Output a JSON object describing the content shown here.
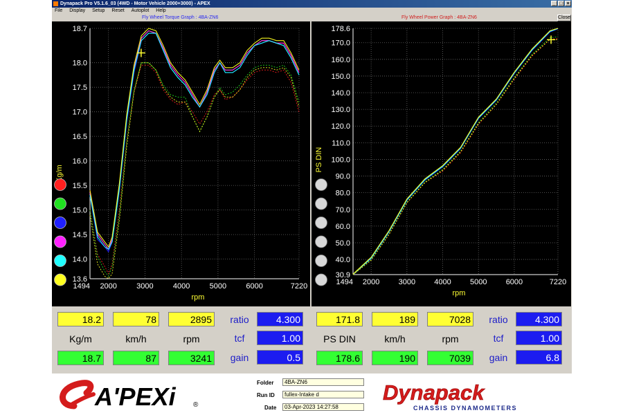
{
  "window": {
    "title": "Dynapack Pro V5.1.6_03 (4WD - Motor Vehicle 2000+3000) - APEX",
    "minimize": "_",
    "maximize": "□",
    "close": "×"
  },
  "menu": [
    "File",
    "Display",
    "Setup",
    "Reset",
    "Autoplot",
    "Help"
  ],
  "close_button": "Close",
  "torque_graph": {
    "title": "Fly Wheel Torque Graph : 4BA-ZN6",
    "ylabel": "Kg/m",
    "xlabel": "rpm"
  },
  "power_graph": {
    "title": "Fly Wheel Power Graph : 4BA-ZN6",
    "ylabel": "PS DIN",
    "xlabel": "rpm"
  },
  "run_colors": [
    "#ff2020",
    "#20e020",
    "#2020ff",
    "#ff20ff",
    "#20ffff",
    "#ffff20"
  ],
  "chart_data": [
    {
      "type": "line",
      "title": "Fly Wheel Torque Graph : 4BA-ZN6",
      "xlabel": "rpm",
      "ylabel": "Kg/m",
      "xlim": [
        1494,
        7220
      ],
      "ylim": [
        13.6,
        18.7
      ],
      "x_ticks": [
        "1494",
        "2000",
        "3000",
        "4000",
        "5000",
        "6000",
        "7220"
      ],
      "y_ticks": [
        "18.7",
        "18.0",
        "17.5",
        "17.0",
        "16.5",
        "16.0",
        "15.5",
        "15.0",
        "14.5",
        "14.0",
        "13.6"
      ],
      "grid": true,
      "series": [
        {
          "color": "#ff2020",
          "dotted": false,
          "x": [
            1494,
            1700,
            1900,
            2000,
            2100,
            2300,
            2500,
            2700,
            2900,
            3100,
            3300,
            3500,
            3700,
            3900,
            4100,
            4300,
            4500,
            4700,
            4900,
            5050,
            5200,
            5400,
            5600,
            5800,
            6000,
            6200,
            6400,
            6600,
            6800,
            7000,
            7220
          ],
          "y": [
            15.4,
            14.5,
            14.3,
            14.2,
            14.4,
            15.5,
            16.9,
            17.9,
            18.5,
            18.65,
            18.6,
            18.3,
            17.95,
            17.75,
            17.6,
            17.35,
            17.1,
            17.4,
            17.85,
            18.0,
            17.85,
            17.85,
            17.95,
            18.2,
            18.35,
            18.45,
            18.45,
            18.4,
            18.4,
            18.15,
            17.8
          ]
        },
        {
          "color": "#20e020",
          "dotted": false,
          "x": [
            1494,
            1700,
            1900,
            2000,
            2100,
            2300,
            2500,
            2700,
            2900,
            3100,
            3300,
            3500,
            3700,
            3900,
            4100,
            4300,
            4500,
            4700,
            4900,
            5050,
            5200,
            5400,
            5600,
            5800,
            6000,
            6200,
            6400,
            6600,
            6800,
            7000,
            7220
          ],
          "y": [
            15.3,
            14.5,
            14.3,
            14.2,
            14.35,
            15.4,
            16.9,
            17.9,
            18.5,
            18.65,
            18.6,
            18.3,
            17.9,
            17.7,
            17.55,
            17.3,
            17.1,
            17.4,
            17.85,
            18.0,
            17.85,
            17.85,
            17.95,
            18.2,
            18.35,
            18.45,
            18.45,
            18.4,
            18.35,
            18.1,
            17.75
          ]
        },
        {
          "color": "#2020ff",
          "dotted": false,
          "x": [
            1494,
            1700,
            1900,
            2000,
            2100,
            2300,
            2500,
            2700,
            2900,
            3100,
            3300,
            3500,
            3700,
            3900,
            4100,
            4300,
            4500,
            4700,
            4900,
            5050,
            5200,
            5400,
            5600,
            5800,
            6000,
            6200,
            6400,
            6600,
            6800,
            7000,
            7220
          ],
          "y": [
            15.3,
            14.4,
            14.25,
            14.15,
            14.35,
            15.4,
            16.8,
            17.8,
            18.45,
            18.6,
            18.6,
            18.25,
            17.9,
            17.7,
            17.55,
            17.3,
            17.1,
            17.35,
            17.8,
            18.0,
            17.8,
            17.8,
            17.9,
            18.15,
            18.35,
            18.4,
            18.45,
            18.4,
            18.35,
            18.1,
            17.75
          ]
        },
        {
          "color": "#ff20ff",
          "dotted": false,
          "x": [
            1494,
            1700,
            1900,
            2000,
            2100,
            2300,
            2500,
            2700,
            2900,
            3100,
            3300,
            3500,
            3700,
            3900,
            4100,
            4300,
            4500,
            4700,
            4900,
            5050,
            5200,
            5400,
            5600,
            5800,
            6000,
            6200,
            6400,
            6600,
            6800,
            7000,
            7220
          ],
          "y": [
            15.35,
            14.5,
            14.3,
            14.2,
            14.4,
            15.5,
            16.9,
            17.9,
            18.5,
            18.65,
            18.6,
            18.3,
            17.95,
            17.75,
            17.6,
            17.35,
            17.1,
            17.4,
            17.85,
            18.0,
            17.85,
            17.85,
            17.95,
            18.2,
            18.35,
            18.45,
            18.45,
            18.4,
            18.4,
            18.15,
            17.8
          ]
        },
        {
          "color": "#20ffff",
          "dotted": false,
          "x": [
            1494,
            1700,
            1900,
            2000,
            2100,
            2300,
            2500,
            2700,
            2900,
            3100,
            3300,
            3500,
            3700,
            3900,
            4100,
            4300,
            4500,
            4700,
            4900,
            5050,
            5200,
            5400,
            5600,
            5800,
            6000,
            6200,
            6400,
            6600,
            6800,
            7000,
            7220
          ],
          "y": [
            15.3,
            14.45,
            14.25,
            14.2,
            14.35,
            15.45,
            16.85,
            17.85,
            18.45,
            18.6,
            18.6,
            18.25,
            17.9,
            17.7,
            17.55,
            17.3,
            17.1,
            17.35,
            17.8,
            18.0,
            17.8,
            17.8,
            17.9,
            18.15,
            18.35,
            18.4,
            18.45,
            18.4,
            18.35,
            18.1,
            17.75
          ]
        },
        {
          "color": "#ffff20",
          "dotted": false,
          "x": [
            1494,
            1700,
            1900,
            2000,
            2100,
            2300,
            2500,
            2700,
            2900,
            3100,
            3300,
            3500,
            3700,
            3900,
            4100,
            4300,
            4500,
            4700,
            4900,
            5050,
            5200,
            5400,
            5600,
            5800,
            6000,
            6200,
            6400,
            6600,
            6800,
            7000,
            7220
          ],
          "y": [
            15.4,
            14.55,
            14.35,
            14.25,
            14.45,
            15.55,
            16.95,
            17.95,
            18.55,
            18.7,
            18.65,
            18.35,
            18.0,
            17.8,
            17.65,
            17.4,
            17.15,
            17.45,
            17.9,
            18.05,
            17.9,
            17.9,
            18.0,
            18.25,
            18.4,
            18.5,
            18.5,
            18.45,
            18.45,
            18.2,
            17.85
          ]
        },
        {
          "color": "#ff2020",
          "dotted": true,
          "x": [
            1494,
            1700,
            1900,
            2000,
            2100,
            2300,
            2500,
            2700,
            2900,
            3100,
            3300,
            3500,
            3700,
            3900,
            4100,
            4300,
            4500,
            4700,
            4900,
            5050,
            5200,
            5400,
            5600,
            5800,
            6000,
            6200,
            6400,
            6600,
            6800,
            7000,
            7220
          ],
          "y": [
            15.0,
            14.1,
            13.85,
            13.7,
            13.9,
            15.0,
            16.4,
            17.4,
            17.95,
            17.95,
            17.8,
            17.45,
            17.25,
            17.15,
            17.2,
            17.0,
            16.75,
            17.0,
            17.35,
            17.45,
            17.25,
            17.3,
            17.45,
            17.65,
            17.8,
            17.85,
            17.85,
            17.8,
            17.85,
            17.6,
            17.0
          ]
        },
        {
          "color": "#20e020",
          "dotted": true,
          "x": [
            1494,
            1700,
            1900,
            2000,
            2100,
            2300,
            2500,
            2700,
            2900,
            3100,
            3300,
            3500,
            3700,
            3900,
            4100,
            4300,
            4500,
            4700,
            4900,
            5050,
            5200,
            5400,
            5600,
            5800,
            6000,
            6200,
            6400,
            6600,
            6800,
            7000,
            7220
          ],
          "y": [
            15.0,
            14.05,
            13.75,
            13.65,
            13.85,
            14.9,
            16.4,
            17.45,
            18.0,
            18.0,
            17.85,
            17.55,
            17.35,
            17.3,
            17.3,
            16.9,
            16.6,
            16.9,
            17.3,
            17.5,
            17.35,
            17.4,
            17.55,
            17.75,
            17.9,
            17.95,
            17.95,
            17.9,
            17.95,
            17.75,
            17.2
          ]
        },
        {
          "color": "#ffff20",
          "dotted": true,
          "x": [
            1494,
            1700,
            1900,
            2000,
            2100,
            2300,
            2500,
            2700,
            2900,
            3100,
            3300,
            3500,
            3700,
            3900,
            4100,
            4300,
            4500,
            4700,
            4900,
            5050,
            5200,
            5400,
            5600,
            5800,
            6000,
            6200,
            6400,
            6600,
            6800,
            7000,
            7220
          ],
          "y": [
            14.9,
            13.9,
            13.65,
            13.6,
            13.7,
            14.8,
            16.3,
            17.4,
            18.0,
            18.0,
            17.85,
            17.5,
            17.3,
            17.2,
            17.2,
            16.9,
            16.6,
            16.9,
            17.3,
            17.45,
            17.3,
            17.3,
            17.45,
            17.7,
            17.85,
            17.9,
            17.9,
            17.85,
            17.9,
            17.7,
            17.1
          ]
        }
      ]
    },
    {
      "type": "line",
      "title": "Fly Wheel Power Graph : 4BA-ZN6",
      "xlabel": "rpm",
      "ylabel": "PS DIN",
      "xlim": [
        1494,
        7220
      ],
      "ylim": [
        30.9,
        178.6
      ],
      "x_ticks": [
        "1494",
        "2000",
        "3000",
        "4000",
        "5000",
        "6000",
        "7220"
      ],
      "y_ticks": [
        "178.6",
        "170.0",
        "160.0",
        "150.0",
        "140.0",
        "130.0",
        "120.0",
        "110.0",
        "100.0",
        "90.0",
        "80.0",
        "70.0",
        "60.0",
        "50.0",
        "40.0",
        "30.9"
      ],
      "grid": true,
      "series": [
        {
          "color": "#ff2020",
          "dotted": false,
          "x": [
            1494,
            2000,
            2500,
            3000,
            3500,
            4000,
            4500,
            5000,
            5500,
            6000,
            6500,
            7000,
            7220
          ],
          "y": [
            30.9,
            41,
            57,
            76,
            88,
            96,
            107,
            125,
            136,
            152,
            166,
            177,
            178.6
          ]
        },
        {
          "color": "#20e020",
          "dotted": false,
          "x": [
            1494,
            2000,
            2500,
            3000,
            3500,
            4000,
            4500,
            5000,
            5500,
            6000,
            6500,
            7000,
            7220
          ],
          "y": [
            30.9,
            41,
            57,
            76,
            88,
            96,
            107,
            125,
            136,
            152,
            166,
            177,
            178.6
          ]
        },
        {
          "color": "#2020ff",
          "dotted": false,
          "x": [
            1494,
            2000,
            2500,
            3000,
            3500,
            4000,
            4500,
            5000,
            5500,
            6000,
            6500,
            7000,
            7220
          ],
          "y": [
            30.9,
            40.5,
            56.5,
            75.5,
            87.5,
            95.5,
            106.5,
            124.5,
            135.5,
            151.5,
            165.5,
            176.5,
            178.3
          ]
        },
        {
          "color": "#ff20ff",
          "dotted": false,
          "x": [
            1494,
            2000,
            2500,
            3000,
            3500,
            4000,
            4500,
            5000,
            5500,
            6000,
            6500,
            7000,
            7220
          ],
          "y": [
            30.9,
            41,
            57,
            76,
            88,
            96,
            107,
            125,
            136,
            152,
            166,
            177,
            178.6
          ]
        },
        {
          "color": "#20ffff",
          "dotted": false,
          "x": [
            1494,
            2000,
            2500,
            3000,
            3500,
            4000,
            4500,
            5000,
            5500,
            6000,
            6500,
            7000,
            7220
          ],
          "y": [
            30.9,
            40.8,
            56.8,
            75.8,
            87.8,
            95.8,
            106.8,
            124.8,
            135.8,
            151.8,
            165.8,
            176.8,
            178.5
          ]
        },
        {
          "color": "#ffff20",
          "dotted": false,
          "x": [
            1494,
            2000,
            2500,
            3000,
            3500,
            4000,
            4500,
            5000,
            5500,
            6000,
            6500,
            7000,
            7220
          ],
          "y": [
            31.2,
            41.3,
            57.3,
            76.3,
            88.3,
            96.3,
            107.3,
            125.3,
            136.3,
            152.3,
            166.3,
            177.2,
            178.6
          ]
        },
        {
          "color": "#ff2020",
          "dotted": true,
          "x": [
            1494,
            2000,
            2500,
            3000,
            3500,
            4000,
            4500,
            5000,
            5500,
            6000,
            6500,
            7000,
            7220
          ],
          "y": [
            30.9,
            40,
            55,
            74,
            86,
            93,
            104,
            121,
            133,
            148,
            162,
            172,
            172.5
          ]
        },
        {
          "color": "#20e020",
          "dotted": true,
          "x": [
            1494,
            2000,
            2500,
            3000,
            3500,
            4000,
            4500,
            5000,
            5500,
            6000,
            6500,
            7000,
            7220
          ],
          "y": [
            30.9,
            40,
            55.5,
            74.5,
            86.5,
            94,
            105,
            122,
            134,
            149,
            163,
            173,
            173.5
          ]
        },
        {
          "color": "#ffff20",
          "dotted": true,
          "x": [
            1494,
            2000,
            2500,
            3000,
            3500,
            4000,
            4500,
            5000,
            5500,
            6000,
            6500,
            7000,
            7220
          ],
          "y": [
            30.9,
            39.5,
            55,
            74,
            86,
            93.5,
            104.5,
            121.5,
            133,
            148.5,
            162.5,
            172,
            171.8
          ]
        }
      ]
    }
  ],
  "readouts": {
    "left": {
      "current": [
        "18.2",
        "78",
        "2895"
      ],
      "labels": [
        "Kg/m",
        "km/h",
        "rpm"
      ],
      "peak": [
        "18.7",
        "87",
        "3241"
      ],
      "ratio_label": "ratio",
      "ratio": "4.300",
      "tcf_label": "tcf",
      "tcf": "1.00",
      "gain_label": "gain",
      "gain": "0.5"
    },
    "right": {
      "current": [
        "171.8",
        "189",
        "7028"
      ],
      "labels": [
        "PS DIN",
        "km/h",
        "rpm"
      ],
      "peak": [
        "178.6",
        "190",
        "7039"
      ],
      "ratio_label": "ratio",
      "ratio": "4.300",
      "tcf_label": "tcf",
      "tcf": "1.00",
      "gain_label": "gain",
      "gain": "6.8"
    }
  },
  "footer": {
    "apexi_logo": "A'PEXi",
    "registered_mark": "®",
    "folder_label": "Folder",
    "folder": "4BA-ZN6",
    "runid_label": "Run ID",
    "runid": "fullex-Intake d",
    "date_label": "Date",
    "date": "03-Apr-2023  14:27:58",
    "dynapack_logo": "Dynapack",
    "dynapack_sub": "CHASSIS DYNAMOMETERS"
  }
}
